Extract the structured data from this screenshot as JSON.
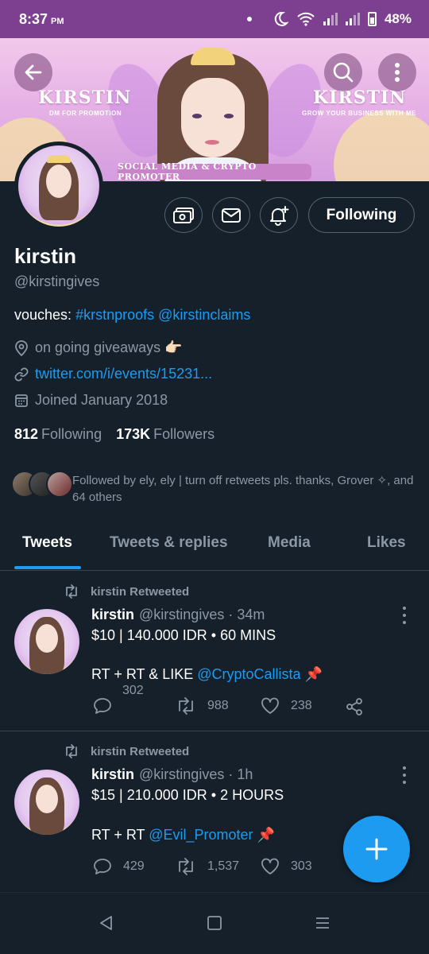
{
  "status_bar": {
    "time": "8:37",
    "ampm": "PM",
    "battery": "48%"
  },
  "banner": {
    "left_title": "KIRSTIN",
    "left_sub": "DM FOR PROMOTION",
    "right_title": "KIRSTIN",
    "right_sub": "GROW YOUR BUSINESS WITH ME",
    "ribbon": "SOCIAL MEDIA & CRYPTO PROMOTER"
  },
  "profile": {
    "name": "kirstin",
    "handle": "@kirstingives",
    "bio_prefix": "vouches:",
    "bio_link1": "#krstnproofs",
    "bio_link2": "@kirstinclaims",
    "location": "on going giveaways 👉🏻",
    "website": "twitter.com/i/events/15231...",
    "joined": "Joined January 2018",
    "following_count": "812",
    "following_label": "Following",
    "followers_count": "173K",
    "followers_label": "Followers",
    "followed_by": "Followed by ely, ely | turn off retweets pls. thanks, Grover ✧, and 64 others",
    "following_button": "Following"
  },
  "tabs": [
    "Tweets",
    "Tweets & replies",
    "Media",
    "Likes"
  ],
  "tweets": [
    {
      "retweeted_by": "kirstin Retweeted",
      "name": "kirstin",
      "handle_time": "@kirstingives · 34m",
      "line1": "$10 | 140.000 IDR • 60 MINS",
      "line2_prefix": "RT + RT & LIKE",
      "line2_mention": "@CryptoCallista",
      "line2_suffix": "📌",
      "replies": "302",
      "retweets": "988",
      "likes": "238"
    },
    {
      "retweeted_by": "kirstin Retweeted",
      "name": "kirstin",
      "handle_time": "@kirstingives · 1h",
      "line1": "$15 | 210.000 IDR • 2 HOURS",
      "line2_prefix": "RT + RT",
      "line2_mention": "@Evil_Promoter",
      "line2_suffix": "📌",
      "replies": "429",
      "retweets": "1,537",
      "likes": "303"
    }
  ],
  "colors": {
    "background": "#15202b",
    "accent": "#1d9bf0",
    "muted": "#8b98a5",
    "status_bar": "#7d3f8f"
  }
}
